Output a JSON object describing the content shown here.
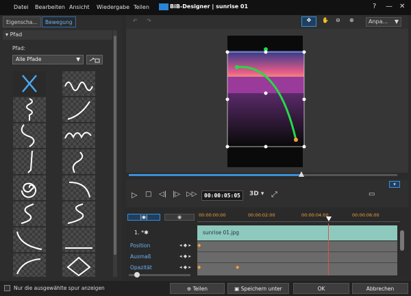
{
  "menu": [
    "Datei",
    "Bearbeiten",
    "Ansicht",
    "Wiedergabe",
    "Teilen"
  ],
  "title": "BiB-Designer  |  sunrise 01",
  "window": {
    "help": "?",
    "minimize": "—",
    "close": "✕"
  },
  "tabs": [
    "Eigenscha...",
    "Bewegung"
  ],
  "section": "Pfad",
  "pfad_label": "Pfad:",
  "pfad_select": "Alle Pfade",
  "zoom": "Anpa...",
  "timecode": "00:00:05:05",
  "mode3d": "3D",
  "ruler": [
    "00:00:00:00",
    "00:00:02:00",
    "00:00:04:00",
    "00:00:06:00"
  ],
  "clip": {
    "index": "1. *✱",
    "name": "sunrise 01.jpg"
  },
  "tracks": [
    "Position",
    "Ausmaß",
    "Opazität"
  ],
  "only_selected": "Nur die ausgewählte spur anzeigen",
  "buttons": {
    "share": "Teilen",
    "save_as": "Speichern unter",
    "ok": "OK",
    "cancel": "Abbrechen"
  },
  "colors": {
    "accent": "#3b8fd9",
    "path": "#22dd44",
    "clip": "#8ec9bd"
  }
}
